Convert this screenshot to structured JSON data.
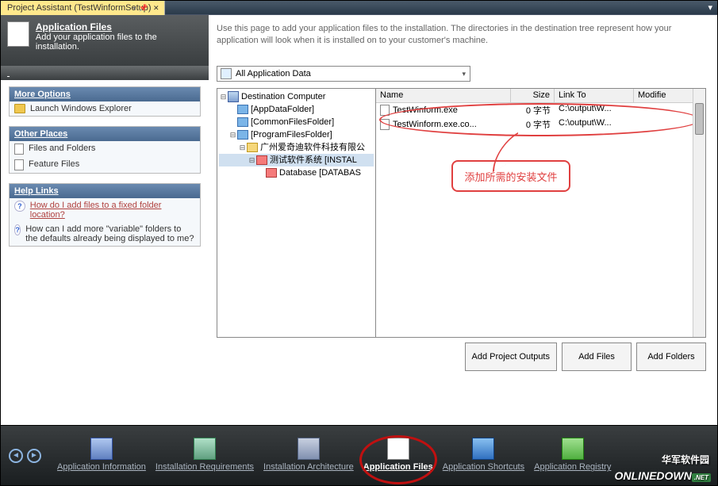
{
  "title": "Project Assistant (TestWinformSetup)",
  "header": {
    "title": "Application Files",
    "subtitle": "Add your application files to the installation."
  },
  "more_options": {
    "head": "More Options",
    "items": [
      "Launch Windows Explorer"
    ]
  },
  "other_places": {
    "head": "Other Places",
    "items": [
      "Files and Folders",
      "Feature Files"
    ]
  },
  "help_links": {
    "head": "Help Links",
    "items": [
      "How do I add files to a fixed folder location?",
      "How can I add more \"variable\" folders to the defaults already being displayed to me?"
    ]
  },
  "instructions": "Use this page to add your application files to the installation. The directories in the destination tree represent how your application will look when it is installed on to your customer's machine.",
  "combo": "All Application Data",
  "tree": {
    "root": "Destination Computer",
    "n1": "[AppDataFolder]",
    "n2": "[CommonFilesFolder]",
    "n3": "[ProgramFilesFolder]",
    "n3a": "广州爱奇迪软件科技有限公",
    "n3b": "测试软件系统 [INSTAL",
    "n3c": "Database [DATABAS"
  },
  "file_cols": {
    "name": "Name",
    "size": "Size",
    "linkto": "Link To",
    "modified": "Modifie"
  },
  "files": [
    {
      "name": "TestWinform.exe",
      "size": "0 字节",
      "link": "C:\\output\\W..."
    },
    {
      "name": "TestWinform.exe.co...",
      "size": "0 字节",
      "link": "C:\\output\\W..."
    }
  ],
  "callout": "添加所需的安装文件",
  "buttons": {
    "addproj": "Add Project Outputs",
    "addfiles": "Add Files",
    "addfolders": "Add Folders"
  },
  "nav": {
    "items": [
      "Application Information",
      "Installation Requirements",
      "Installation Architecture",
      "Application Files",
      "Application Shortcuts",
      "Application Registry"
    ]
  },
  "logo1": "华军软件园",
  "logo2": "ONLINEDOWN",
  "logo3": ".NET"
}
